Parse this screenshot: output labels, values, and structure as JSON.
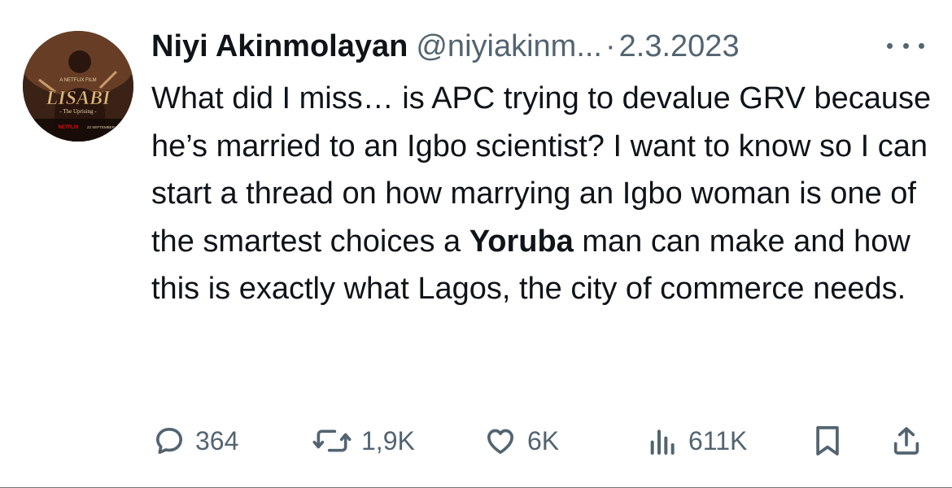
{
  "avatar": {
    "poster_title": "LISABI",
    "poster_subtitle": "- The Uprising -",
    "poster_top_text": "A NETFLIX FILM",
    "poster_netflix": "NETFLIX",
    "poster_date": "22 SEPTEMBER"
  },
  "tweet": {
    "author_name": "Niyi Akinmolayan",
    "handle": "@niyiakinm...",
    "separator": "·",
    "date": "2.3.2023",
    "text_before_bold": "What did I miss… is APC trying to devalue GRV because he’s married to an Igbo scientist? I want to know so I can start a thread on how marrying an Igbo woman is one of the smartest choices a ",
    "text_bold": "Yoruba",
    "text_after_bold": " man can make and how this is exactly what Lagos, the city of commerce needs."
  },
  "actions": {
    "replies": "364",
    "reposts": "1,9K",
    "likes": "6K",
    "views": "611K"
  },
  "colors": {
    "text_primary": "#0f1419",
    "text_secondary": "#536471",
    "background": "#ffffff"
  },
  "icons": [
    "reply-icon",
    "repost-icon",
    "like-icon",
    "views-icon",
    "bookmark-icon",
    "share-icon",
    "more-icon"
  ]
}
